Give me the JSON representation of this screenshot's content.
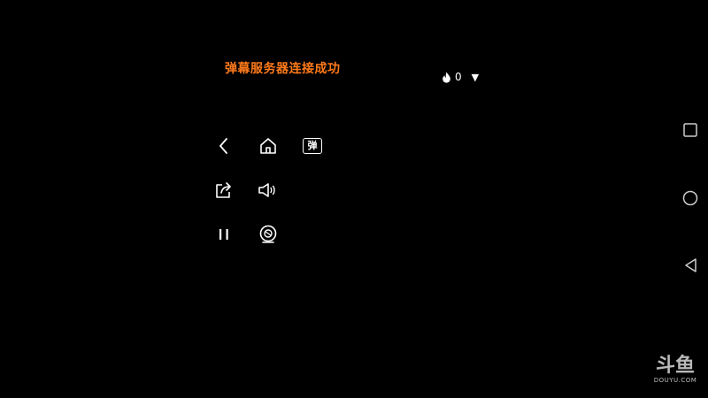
{
  "toast": {
    "text": "弹幕服务器连接成功",
    "color": "#ff7a1a"
  },
  "heat": {
    "count": "0",
    "flame_icon": "flame-icon",
    "caret_icon": "caret-down-icon",
    "caret_glyph": "▼"
  },
  "controls": {
    "back_icon": "back-chevron-icon",
    "home_icon": "home-icon",
    "danmaku_label": "弹",
    "share_icon": "share-icon",
    "volume_icon": "volume-icon",
    "pause_icon": "pause-icon",
    "camera_icon": "camera-icon"
  },
  "system_nav": {
    "recents_icon": "square-recents-icon",
    "home_icon": "circle-home-icon",
    "back_icon": "triangle-back-icon"
  },
  "watermark": {
    "logo_text": "斗鱼",
    "domain": "DOUYU.COM"
  }
}
